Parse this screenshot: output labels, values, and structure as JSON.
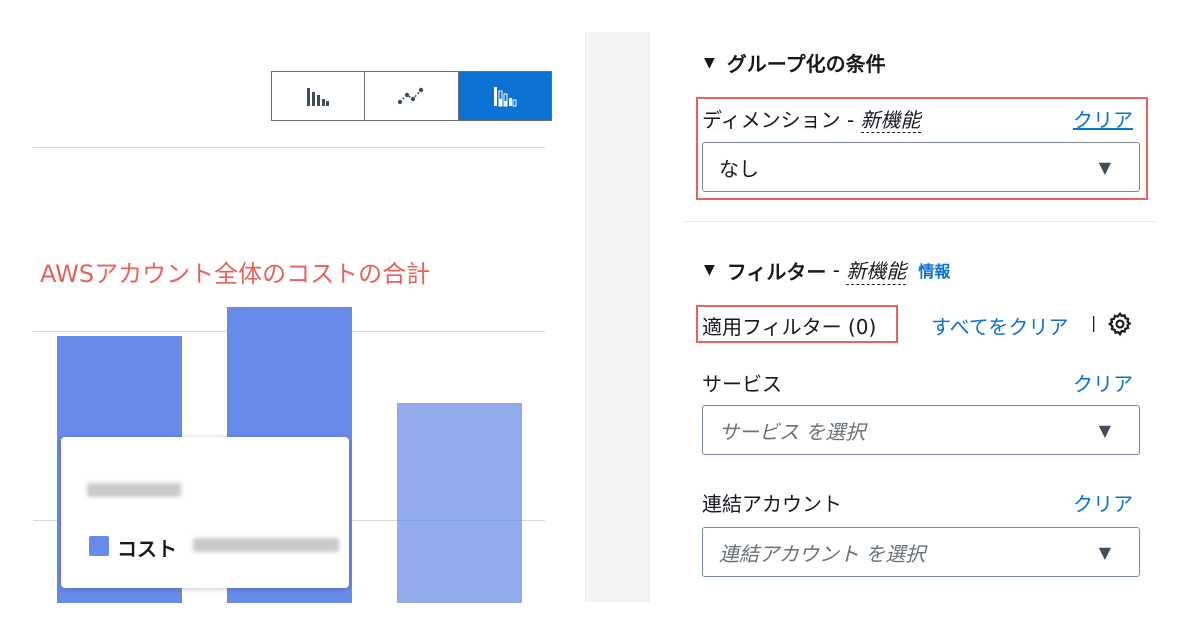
{
  "chart": {
    "annotation_title": "AWSアカウント全体のコストの合計",
    "toggle_icons": [
      "bar-chart-icon",
      "line-chart-icon",
      "stacked-bar-chart-icon"
    ],
    "active_toggle": "stacked-bar-chart-icon",
    "bar_color": "#688ae8",
    "tooltip": {
      "series_label": "コスト"
    }
  },
  "chart_data": {
    "type": "bar",
    "values": [
      1.0,
      1.11,
      0.75
    ],
    "value_note_unit": "relative height (top of first bar = 1.0)"
  },
  "panel": {
    "group_by": {
      "title": "グループ化の条件",
      "dimension_label": "ディメンション",
      "dimension_sep": " - ",
      "new_feature": "新機能",
      "clear": "クリア",
      "dimension_value": "なし"
    },
    "filters": {
      "title": "フィルター",
      "sep": " - ",
      "new_feature": "新機能",
      "info": "情報",
      "applied": "適用フィルター (0)",
      "clear_all": "すべてをクリア",
      "pipe": "|",
      "service_label": "サービス",
      "service_clear": "クリア",
      "service_placeholder": "サービス を選択",
      "account_label": "連結アカウント",
      "account_clear": "クリア",
      "account_placeholder": "連結アカウント を選択"
    },
    "highlight_color": "#e8625a",
    "link_color": "#0972d3"
  }
}
